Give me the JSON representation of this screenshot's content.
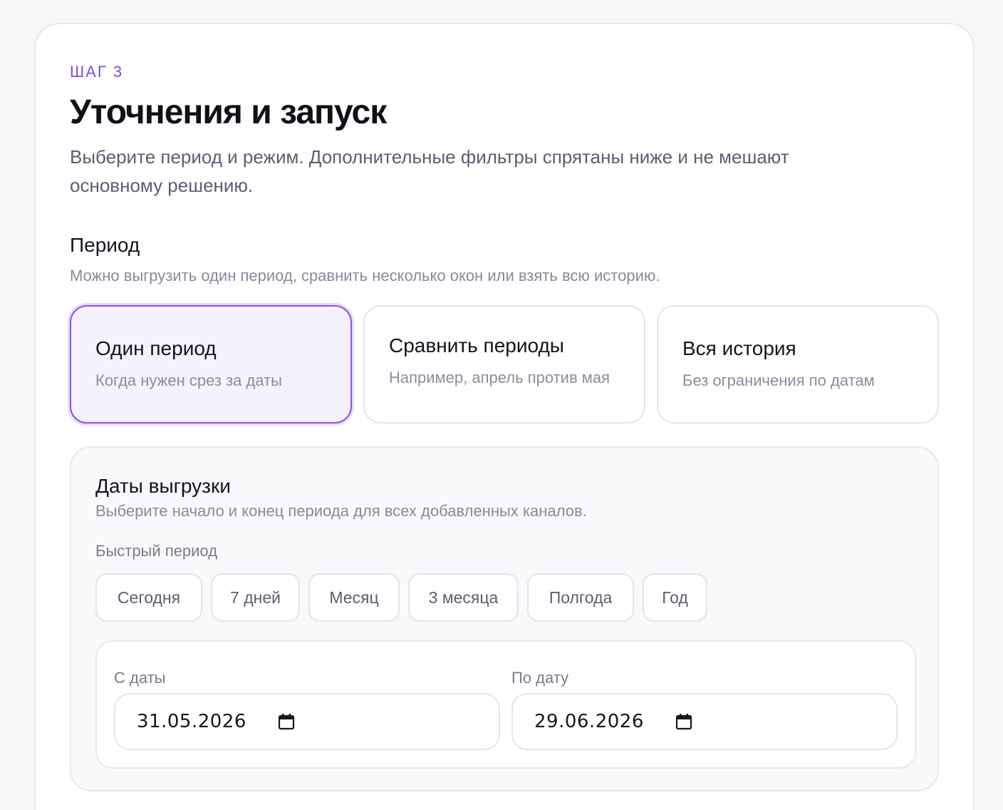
{
  "step": {
    "label": "ШАГ 3",
    "title": "Уточнения и запуск",
    "subtitle": "Выберите период и режим. Дополнительные фильтры спрятаны ниже и не мешают основному решению."
  },
  "period": {
    "title": "Период",
    "subtitle": "Можно выгрузить один период, сравнить несколько окон или взять всю историю.",
    "selected_index": 0,
    "options": [
      {
        "title": "Один период",
        "desc": "Когда нужен срез за даты"
      },
      {
        "title": "Сравнить периоды",
        "desc": "Например, апрель против мая"
      },
      {
        "title": "Вся история",
        "desc": "Без ограничения по датам"
      }
    ]
  },
  "dates": {
    "title": "Даты выгрузки",
    "subtitle": "Выберите начало и конец периода для всех добавленных каналов.",
    "quick_label": "Быстрый период",
    "quick": [
      "Сегодня",
      "7 дней",
      "Месяц",
      "3 месяца",
      "Полгода",
      "Год"
    ],
    "from_label": "С даты",
    "from_value": "31.05.2026",
    "to_label": "По дату",
    "to_value": "29.06.2026",
    "calendar_icon": "calendar-icon"
  },
  "colors": {
    "accent": "#7c4ddb",
    "selected_border": "#8a55e6",
    "selected_bg": "#f5f1fd",
    "text": "#15141e",
    "muted": "#8b889a"
  }
}
